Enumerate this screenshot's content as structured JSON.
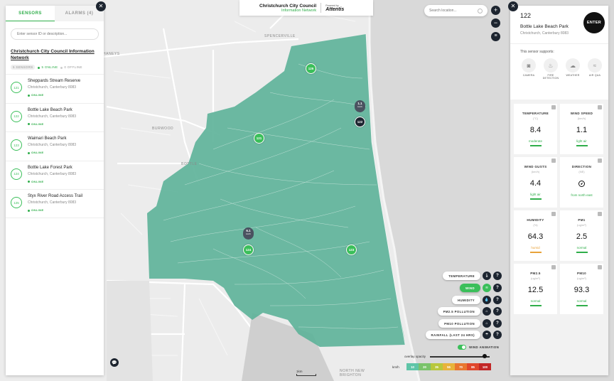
{
  "left_panel": {
    "tabs": [
      {
        "label": "SENSORS",
        "active": true
      },
      {
        "label": "ALARMS (4)",
        "active": false
      }
    ],
    "search_placeholder": "Enter sensor ID or description...",
    "network_title": "Christchurch City Council Information Network",
    "stats": {
      "sensors": "5 SENSORS",
      "online": "5 ONLINE",
      "offline": "0 OFFLINE"
    },
    "sensors": [
      {
        "id": "121",
        "name": "Sheppards Stream Reserve",
        "location": "Christchurch, Canterbury 8083",
        "status": "ONLINE"
      },
      {
        "id": "122",
        "name": "Bottle Lake Beach Park",
        "location": "Christchurch, Canterbury 8083",
        "status": "ONLINE"
      },
      {
        "id": "123",
        "name": "Waimari Beach Park",
        "location": "Christchurch, Canterbury 8083",
        "status": "ONLINE"
      },
      {
        "id": "124",
        "name": "Bottle Lake Forest Park",
        "location": "Christchurch, Canterbury 8083",
        "status": "ONLINE"
      },
      {
        "id": "125",
        "name": "Styx River Road Access Trail",
        "location": "Christchurch, Canterbury 8083",
        "status": "ONLINE"
      }
    ]
  },
  "header": {
    "title": "Christchurch City Council",
    "subtitle": "Information Network",
    "powered_by": "Powered by",
    "brand": "Attentis"
  },
  "map": {
    "location_placeholder": "Search location...",
    "labels": {
      "haneys": "HANEYS",
      "spencerville": "SPENCERVILLE",
      "burwood": "BURWOOD",
      "bottle": "BOTTLE",
      "north_new_brighton": "NORTH NEW\nBRIGHTON"
    },
    "markers": [
      {
        "label": "125",
        "color": "green"
      },
      {
        "label": "121",
        "color": "green"
      },
      {
        "label": "122",
        "color": "dark"
      },
      {
        "label": "124",
        "color": "green"
      },
      {
        "label": "123",
        "color": "green"
      }
    ],
    "wind_tags": [
      {
        "value": "1.1",
        "unit": "km/h"
      },
      {
        "value": "6.1",
        "unit": "km/h"
      }
    ],
    "layers": [
      {
        "label": "TEMPERATURE",
        "icon": "thermometer-icon",
        "active": false
      },
      {
        "label": "WIND",
        "icon": "wind-icon",
        "active": true
      },
      {
        "label": "HUMIDITY",
        "icon": "droplet-icon",
        "active": false
      },
      {
        "label": "PM2.5 POLLUTION",
        "icon": "factory-icon",
        "active": false
      },
      {
        "label": "PM10 POLLUTION",
        "icon": "factory-icon",
        "active": false
      },
      {
        "label": "RAINFALL (LAST 24 HRS)",
        "icon": "rain-icon",
        "active": false
      }
    ],
    "wind_animation_label": "WIND ANIMATION",
    "overlay_opacity_label": "overlay opacity",
    "overlay_opacity": 0.92,
    "legend_unit": "km/h",
    "legend": [
      {
        "value": "10",
        "color": "#5fc5a8"
      },
      {
        "value": "20",
        "color": "#7ac36a"
      },
      {
        "value": "35",
        "color": "#b8c73c"
      },
      {
        "value": "55",
        "color": "#e8b33a"
      },
      {
        "value": "70",
        "color": "#e9762f"
      },
      {
        "value": "85",
        "color": "#e0462b"
      },
      {
        "value": "100",
        "color": "#c22626"
      }
    ],
    "scale_label": "1km"
  },
  "right_panel": {
    "id": "122",
    "name": "Bottle Lake Beach Park",
    "location": "Christchurch, Canterbury 8083",
    "enter_label": "ENTER",
    "supports_title": "This sensor supports:",
    "supports": [
      {
        "label": "CAMERA",
        "icon": "camera-icon"
      },
      {
        "label": "FIRE DETECTION",
        "icon": "fire-icon"
      },
      {
        "label": "WEATHER",
        "icon": "cloud-icon"
      },
      {
        "label": "AIR QUA",
        "icon": "air-icon"
      }
    ],
    "metrics": [
      {
        "label": "TEMPERATURE",
        "unit": "(°C)",
        "value": "8.4",
        "desc": "moderate",
        "warn": false
      },
      {
        "label": "WIND SPEED",
        "unit": "(km/h)",
        "value": "1.1",
        "desc": "light air",
        "warn": false
      },
      {
        "label": "WIND GUSTS",
        "unit": "(km/h)",
        "value": "4.4",
        "desc": "light air",
        "warn": false
      },
      {
        "label": "DIRECTION",
        "unit": "(NE)",
        "value": "",
        "desc": "from north east",
        "warn": false,
        "compass": true
      },
      {
        "label": "HUMIDITY",
        "unit": "(%)",
        "value": "64.3",
        "desc": "humid",
        "warn": true
      },
      {
        "label": "PM1",
        "unit": "(ug/m³)",
        "value": "2.5",
        "desc": "normal",
        "warn": false
      },
      {
        "label": "PM2.5",
        "unit": "(ug/m³)",
        "value": "12.5",
        "desc": "normal",
        "warn": false
      },
      {
        "label": "PM10",
        "unit": "(ug/m³)",
        "value": "93.3",
        "desc": "normal",
        "warn": false
      }
    ]
  },
  "colors": {
    "accent": "#3bbf5a",
    "dark": "#1d2530",
    "overlay": "#5fb39a"
  }
}
